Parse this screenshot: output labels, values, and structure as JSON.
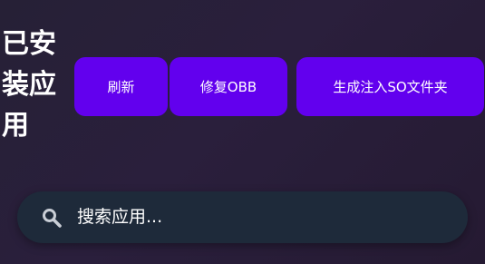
{
  "header": {
    "title": "已安装应用"
  },
  "toolbar": {
    "refresh_label": "刷新",
    "fix_obb_label": "修复OBB",
    "generate_so_folder_label": "生成注入SO文件夹"
  },
  "search": {
    "placeholder": "搜索应用...",
    "value": "",
    "icon": "search-icon"
  },
  "colors": {
    "button_background": "#6200ee",
    "search_background": "#1e2a3a",
    "text": "#ffffff"
  }
}
